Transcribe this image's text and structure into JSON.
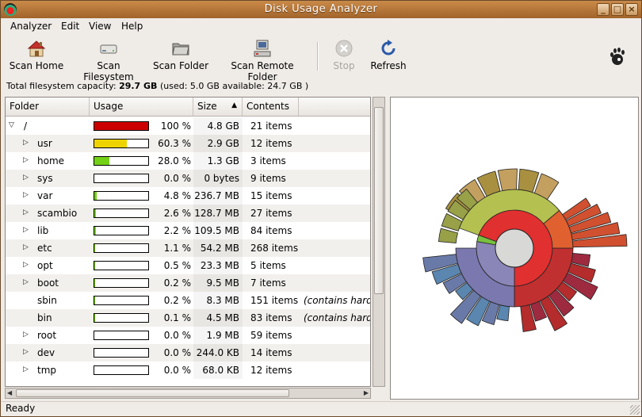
{
  "window": {
    "title": "Disk Usage Analyzer"
  },
  "menu": [
    "Analyzer",
    "Edit",
    "View",
    "Help"
  ],
  "toolbar": {
    "scan_home": "Scan Home",
    "scan_filesystem": "Scan Filesystem",
    "scan_folder": "Scan Folder",
    "scan_remote": "Scan Remote Folder",
    "stop": "Stop",
    "refresh": "Refresh"
  },
  "capacity": {
    "prefix": "Total filesystem capacity:",
    "total": "29.7 GB",
    "detail": "(used: 5.0 GB available: 24.7 GB )"
  },
  "columns": {
    "folder": "Folder",
    "usage": "Usage",
    "size": "Size",
    "contents": "Contents"
  },
  "rows": [
    {
      "name": "/",
      "usage": 1.0,
      "pct": "100 %",
      "size": "4.8 GB",
      "contents": "21 items",
      "note": "",
      "expander": "open",
      "level": 0,
      "color": "#cc0000"
    },
    {
      "name": "usr",
      "usage": 0.603,
      "pct": "60.3 %",
      "size": "2.9 GB",
      "contents": "12 items",
      "note": "",
      "expander": "closed",
      "level": 1,
      "color": "#edd400"
    },
    {
      "name": "home",
      "usage": 0.28,
      "pct": "28.0 %",
      "size": "1.3 GB",
      "contents": "3 items",
      "note": "",
      "expander": "closed",
      "level": 1,
      "color": "#73d216"
    },
    {
      "name": "sys",
      "usage": 0.0,
      "pct": "0.0 %",
      "size": "0 bytes",
      "contents": "9 items",
      "note": "",
      "expander": "closed",
      "level": 1,
      "color": "#73d216"
    },
    {
      "name": "var",
      "usage": 0.048,
      "pct": "4.8 %",
      "size": "236.7 MB",
      "contents": "15 items",
      "note": "",
      "expander": "closed",
      "level": 1,
      "color": "#73d216"
    },
    {
      "name": "scambio",
      "usage": 0.026,
      "pct": "2.6 %",
      "size": "128.7 MB",
      "contents": "27 items",
      "note": "",
      "expander": "closed",
      "level": 1,
      "color": "#73d216"
    },
    {
      "name": "lib",
      "usage": 0.022,
      "pct": "2.2 %",
      "size": "109.5 MB",
      "contents": "84 items",
      "note": "",
      "expander": "closed",
      "level": 1,
      "color": "#73d216"
    },
    {
      "name": "etc",
      "usage": 0.011,
      "pct": "1.1 %",
      "size": "54.2 MB",
      "contents": "268 items",
      "note": "",
      "expander": "closed",
      "level": 1,
      "color": "#73d216"
    },
    {
      "name": "opt",
      "usage": 0.005,
      "pct": "0.5 %",
      "size": "23.3 MB",
      "contents": "5 items",
      "note": "",
      "expander": "closed",
      "level": 1,
      "color": "#73d216"
    },
    {
      "name": "boot",
      "usage": 0.002,
      "pct": "0.2 %",
      "size": "9.5 MB",
      "contents": "7 items",
      "note": "",
      "expander": "closed",
      "level": 1,
      "color": "#73d216"
    },
    {
      "name": "sbin",
      "usage": 0.002,
      "pct": "0.2 %",
      "size": "8.3 MB",
      "contents": "151 items",
      "note": "(contains hardl",
      "expander": "",
      "level": 1,
      "color": "#73d216"
    },
    {
      "name": "bin",
      "usage": 0.001,
      "pct": "0.1 %",
      "size": "4.5 MB",
      "contents": "83 items",
      "note": "(contains hardl",
      "expander": "",
      "level": 1,
      "color": "#73d216"
    },
    {
      "name": "root",
      "usage": 0.0,
      "pct": "0.0 %",
      "size": "1.9 MB",
      "contents": "59 items",
      "note": "",
      "expander": "closed",
      "level": 1,
      "color": "#73d216"
    },
    {
      "name": "dev",
      "usage": 0.0,
      "pct": "0.0 %",
      "size": "244.0 KB",
      "contents": "14 items",
      "note": "",
      "expander": "closed",
      "level": 1,
      "color": "#73d216"
    },
    {
      "name": "tmp",
      "usage": 0.0,
      "pct": "0.0 %",
      "size": "68.0 KB",
      "contents": "12 items",
      "note": "",
      "expander": "closed",
      "level": 1,
      "color": "#73d216"
    }
  ],
  "status": "Ready",
  "colors": {
    "titlebar": "#b3743a",
    "accent": "#cc0000",
    "usr": "#edd400",
    "home": "#73d216"
  }
}
